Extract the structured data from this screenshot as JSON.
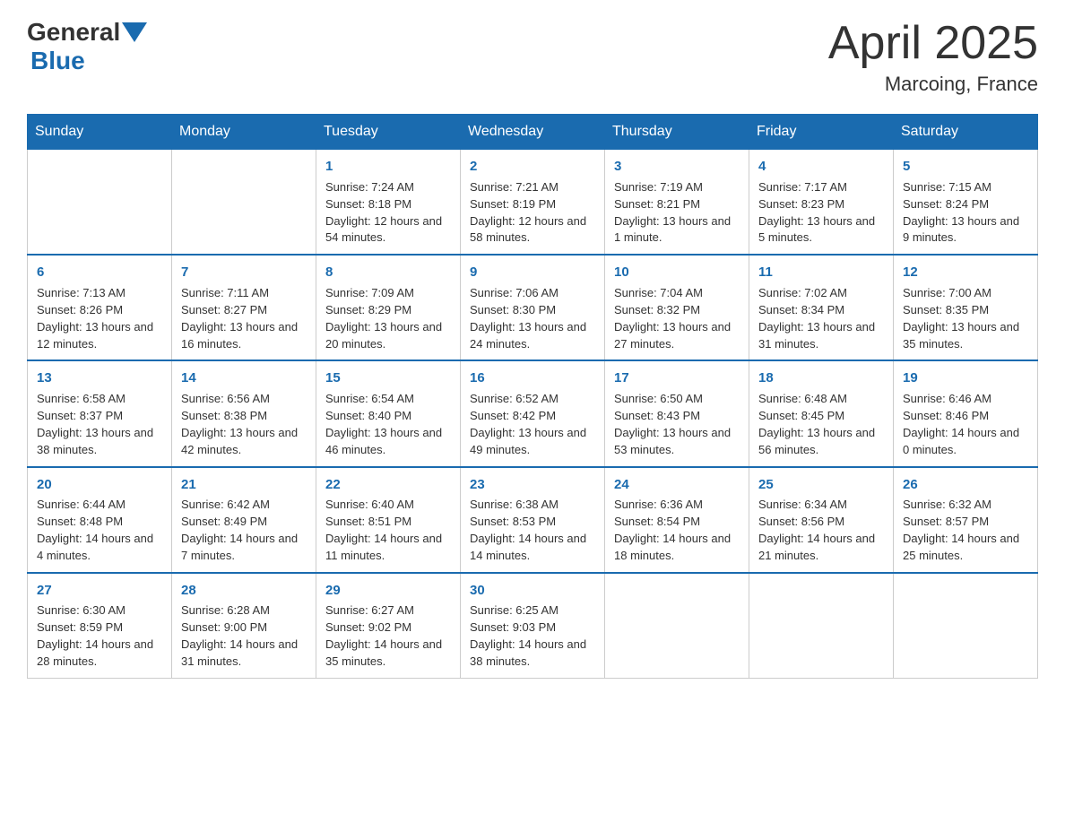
{
  "header": {
    "logo": {
      "general": "General",
      "blue": "Blue"
    },
    "title": "April 2025",
    "location": "Marcoing, France"
  },
  "calendar": {
    "days_of_week": [
      "Sunday",
      "Monday",
      "Tuesday",
      "Wednesday",
      "Thursday",
      "Friday",
      "Saturday"
    ],
    "weeks": [
      [
        {
          "day": "",
          "info": ""
        },
        {
          "day": "",
          "info": ""
        },
        {
          "day": "1",
          "sunrise": "7:24 AM",
          "sunset": "8:18 PM",
          "daylight": "12 hours and 54 minutes."
        },
        {
          "day": "2",
          "sunrise": "7:21 AM",
          "sunset": "8:19 PM",
          "daylight": "12 hours and 58 minutes."
        },
        {
          "day": "3",
          "sunrise": "7:19 AM",
          "sunset": "8:21 PM",
          "daylight": "13 hours and 1 minute."
        },
        {
          "day": "4",
          "sunrise": "7:17 AM",
          "sunset": "8:23 PM",
          "daylight": "13 hours and 5 minutes."
        },
        {
          "day": "5",
          "sunrise": "7:15 AM",
          "sunset": "8:24 PM",
          "daylight": "13 hours and 9 minutes."
        }
      ],
      [
        {
          "day": "6",
          "sunrise": "7:13 AM",
          "sunset": "8:26 PM",
          "daylight": "13 hours and 12 minutes."
        },
        {
          "day": "7",
          "sunrise": "7:11 AM",
          "sunset": "8:27 PM",
          "daylight": "13 hours and 16 minutes."
        },
        {
          "day": "8",
          "sunrise": "7:09 AM",
          "sunset": "8:29 PM",
          "daylight": "13 hours and 20 minutes."
        },
        {
          "day": "9",
          "sunrise": "7:06 AM",
          "sunset": "8:30 PM",
          "daylight": "13 hours and 24 minutes."
        },
        {
          "day": "10",
          "sunrise": "7:04 AM",
          "sunset": "8:32 PM",
          "daylight": "13 hours and 27 minutes."
        },
        {
          "day": "11",
          "sunrise": "7:02 AM",
          "sunset": "8:34 PM",
          "daylight": "13 hours and 31 minutes."
        },
        {
          "day": "12",
          "sunrise": "7:00 AM",
          "sunset": "8:35 PM",
          "daylight": "13 hours and 35 minutes."
        }
      ],
      [
        {
          "day": "13",
          "sunrise": "6:58 AM",
          "sunset": "8:37 PM",
          "daylight": "13 hours and 38 minutes."
        },
        {
          "day": "14",
          "sunrise": "6:56 AM",
          "sunset": "8:38 PM",
          "daylight": "13 hours and 42 minutes."
        },
        {
          "day": "15",
          "sunrise": "6:54 AM",
          "sunset": "8:40 PM",
          "daylight": "13 hours and 46 minutes."
        },
        {
          "day": "16",
          "sunrise": "6:52 AM",
          "sunset": "8:42 PM",
          "daylight": "13 hours and 49 minutes."
        },
        {
          "day": "17",
          "sunrise": "6:50 AM",
          "sunset": "8:43 PM",
          "daylight": "13 hours and 53 minutes."
        },
        {
          "day": "18",
          "sunrise": "6:48 AM",
          "sunset": "8:45 PM",
          "daylight": "13 hours and 56 minutes."
        },
        {
          "day": "19",
          "sunrise": "6:46 AM",
          "sunset": "8:46 PM",
          "daylight": "14 hours and 0 minutes."
        }
      ],
      [
        {
          "day": "20",
          "sunrise": "6:44 AM",
          "sunset": "8:48 PM",
          "daylight": "14 hours and 4 minutes."
        },
        {
          "day": "21",
          "sunrise": "6:42 AM",
          "sunset": "8:49 PM",
          "daylight": "14 hours and 7 minutes."
        },
        {
          "day": "22",
          "sunrise": "6:40 AM",
          "sunset": "8:51 PM",
          "daylight": "14 hours and 11 minutes."
        },
        {
          "day": "23",
          "sunrise": "6:38 AM",
          "sunset": "8:53 PM",
          "daylight": "14 hours and 14 minutes."
        },
        {
          "day": "24",
          "sunrise": "6:36 AM",
          "sunset": "8:54 PM",
          "daylight": "14 hours and 18 minutes."
        },
        {
          "day": "25",
          "sunrise": "6:34 AM",
          "sunset": "8:56 PM",
          "daylight": "14 hours and 21 minutes."
        },
        {
          "day": "26",
          "sunrise": "6:32 AM",
          "sunset": "8:57 PM",
          "daylight": "14 hours and 25 minutes."
        }
      ],
      [
        {
          "day": "27",
          "sunrise": "6:30 AM",
          "sunset": "8:59 PM",
          "daylight": "14 hours and 28 minutes."
        },
        {
          "day": "28",
          "sunrise": "6:28 AM",
          "sunset": "9:00 PM",
          "daylight": "14 hours and 31 minutes."
        },
        {
          "day": "29",
          "sunrise": "6:27 AM",
          "sunset": "9:02 PM",
          "daylight": "14 hours and 35 minutes."
        },
        {
          "day": "30",
          "sunrise": "6:25 AM",
          "sunset": "9:03 PM",
          "daylight": "14 hours and 38 minutes."
        },
        {
          "day": "",
          "info": ""
        },
        {
          "day": "",
          "info": ""
        },
        {
          "day": "",
          "info": ""
        }
      ]
    ]
  }
}
